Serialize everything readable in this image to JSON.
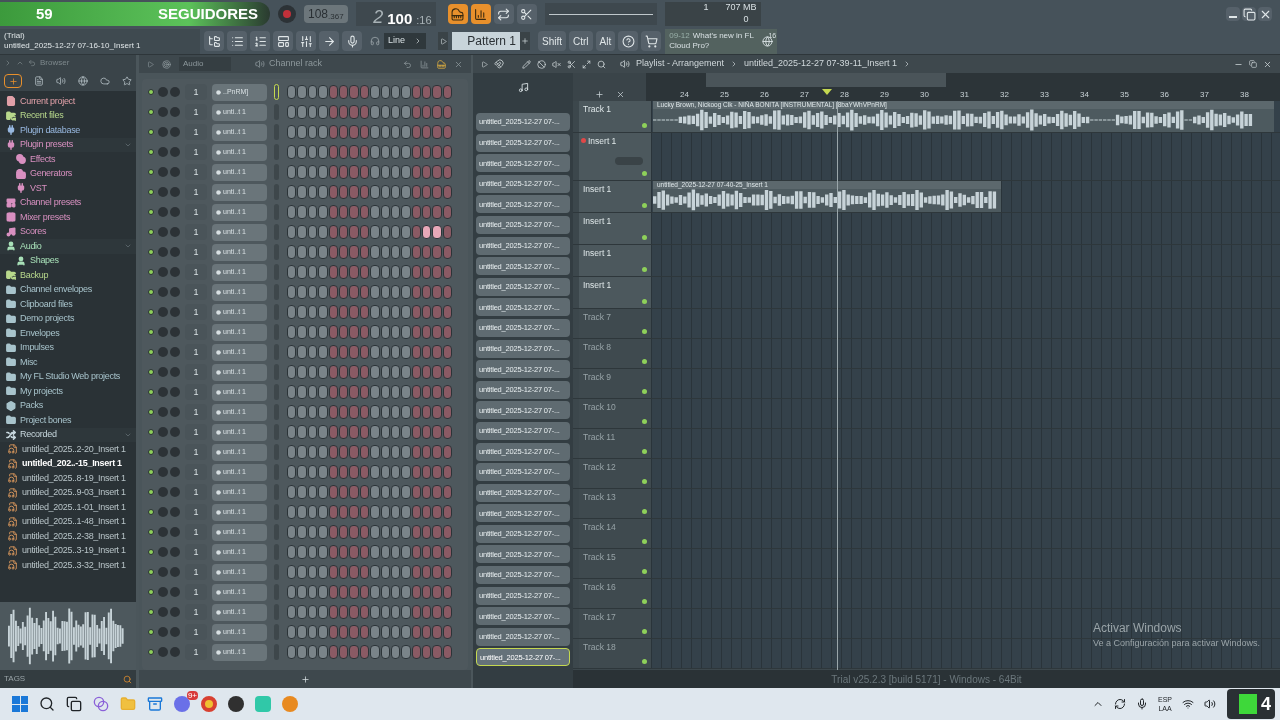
{
  "banner": {
    "count": "59",
    "label": "SEGUIDORES"
  },
  "transport": {
    "tempo": "108",
    "tempo_fraction": ".367",
    "time_bar": "2",
    "time_main": "100",
    "time_sub": ":16"
  },
  "monitor": {
    "cpu": "1",
    "ram": "707 MB",
    "voices": "0"
  },
  "hint_bar": {
    "mode": "(Trial)",
    "text": "untitled_2025-12-27 07-16-10_Insert 1"
  },
  "snap": "Line",
  "pattern": "Pattern 1",
  "modifiers": [
    "Shift",
    "Ctrl",
    "Alt"
  ],
  "news": {
    "date": "09-12",
    "text": "What's new in FL Cloud Pro?",
    "badge": "16"
  },
  "browser": {
    "title": "Browser",
    "tags_label": "TAGS",
    "items": [
      {
        "name": "Current project",
        "kind": "project",
        "color": "#e0a0a8"
      },
      {
        "name": "Recent files",
        "kind": "recent",
        "color": "#b8d88c"
      },
      {
        "name": "Plugin database",
        "kind": "plugin",
        "color": "#98b8e0"
      },
      {
        "name": "Plugin presets",
        "kind": "plugin",
        "color": "#d890c0",
        "expanded": true,
        "children": [
          {
            "name": "Effects",
            "kind": "effects",
            "color": "#d890c0"
          },
          {
            "name": "Generators",
            "kind": "generators",
            "color": "#d890c0"
          },
          {
            "name": "VST",
            "kind": "plugin",
            "color": "#d890c0"
          }
        ]
      },
      {
        "name": "Channel presets",
        "kind": "preset",
        "color": "#d890c0"
      },
      {
        "name": "Mixer presets",
        "kind": "mixer",
        "color": "#d890c0"
      },
      {
        "name": "Scores",
        "kind": "score",
        "color": "#d890c0"
      },
      {
        "name": "Audio",
        "kind": "audio",
        "color": "#a8e0b8",
        "expanded": true,
        "children": [
          {
            "name": "Shapes",
            "kind": "audio",
            "color": "#a8e0b8"
          }
        ]
      },
      {
        "name": "Backup",
        "kind": "recent",
        "color": "#b8d88c"
      },
      {
        "name": "Channel envelopes",
        "kind": "folder",
        "color": "#a8c4cc"
      },
      {
        "name": "Clipboard files",
        "kind": "folder",
        "color": "#a8c4cc"
      },
      {
        "name": "Demo projects",
        "kind": "folder",
        "color": "#a8c4cc"
      },
      {
        "name": "Envelopes",
        "kind": "folder",
        "color": "#a8c4cc"
      },
      {
        "name": "Impulses",
        "kind": "folder",
        "color": "#a8c4cc"
      },
      {
        "name": "Misc",
        "kind": "folder",
        "color": "#a8c4cc"
      },
      {
        "name": "My FL Studio Web projects",
        "kind": "folder",
        "color": "#a8c4cc"
      },
      {
        "name": "My projects",
        "kind": "folder",
        "color": "#a8c4cc"
      },
      {
        "name": "Packs",
        "kind": "packs",
        "color": "#a8c4cc"
      },
      {
        "name": "Project bones",
        "kind": "folder",
        "color": "#a8c4cc"
      },
      {
        "name": "Recorded",
        "kind": "recorded",
        "color": "#c8d8de",
        "expanded": true,
        "children": [
          {
            "name": "untitled_2025..2-20_Insert 1",
            "kind": "file",
            "selected": false
          },
          {
            "name": "untitled_202..-15_Insert 1",
            "kind": "file",
            "selected": true
          },
          {
            "name": "untitled_2025..8-19_Insert 1",
            "kind": "file",
            "selected": false
          },
          {
            "name": "untitled_2025..9-03_Insert 1",
            "kind": "file",
            "selected": false
          },
          {
            "name": "untitled_2025..1-01_Insert 1",
            "kind": "file",
            "selected": false
          },
          {
            "name": "untitled_2025..1-48_Insert 1",
            "kind": "file",
            "selected": false
          },
          {
            "name": "untitled_2025..2-38_Insert 1",
            "kind": "file",
            "selected": false
          },
          {
            "name": "untitled_2025..3-19_Insert 1",
            "kind": "file",
            "selected": false
          },
          {
            "name": "untitled_2025..3-32_Insert 1",
            "kind": "file",
            "selected": false
          }
        ]
      }
    ]
  },
  "channel_rack": {
    "filter": "Audio",
    "title": "Channel rack",
    "channels": [
      {
        "name": "..PnRM]",
        "route": "1",
        "selected": true,
        "steps": [
          false,
          false,
          false,
          false,
          false,
          false,
          false,
          false,
          false,
          false,
          false,
          false,
          false,
          false,
          false,
          false
        ]
      },
      {
        "name": "unti..t 1",
        "route": "1",
        "selected": false,
        "steps": [
          false,
          false,
          false,
          false,
          false,
          false,
          false,
          false,
          false,
          false,
          false,
          false,
          false,
          false,
          false,
          false
        ]
      },
      {
        "name": "unti..t 1",
        "route": "1",
        "selected": false,
        "steps": [
          false,
          false,
          false,
          false,
          false,
          false,
          false,
          false,
          false,
          false,
          false,
          false,
          false,
          false,
          false,
          false
        ]
      },
      {
        "name": "unti..t 1",
        "route": "1",
        "selected": false,
        "steps": [
          false,
          false,
          false,
          false,
          false,
          false,
          false,
          false,
          false,
          false,
          false,
          false,
          false,
          false,
          false,
          false
        ]
      },
      {
        "name": "unti..t 1",
        "route": "1",
        "selected": false,
        "steps": [
          false,
          false,
          false,
          false,
          false,
          false,
          false,
          false,
          false,
          false,
          false,
          false,
          false,
          false,
          false,
          false
        ]
      },
      {
        "name": "unti..t 1",
        "route": "1",
        "selected": false,
        "steps": [
          false,
          false,
          false,
          false,
          false,
          false,
          false,
          false,
          false,
          false,
          false,
          false,
          false,
          false,
          false,
          false
        ]
      },
      {
        "name": "unti..t 1",
        "route": "1",
        "selected": false,
        "steps": [
          false,
          false,
          false,
          false,
          false,
          false,
          false,
          false,
          false,
          false,
          false,
          false,
          false,
          false,
          false,
          false
        ]
      },
      {
        "name": "unti..t 1",
        "route": "1",
        "selected": false,
        "steps": [
          false,
          false,
          false,
          false,
          false,
          false,
          false,
          false,
          false,
          false,
          false,
          false,
          false,
          true,
          true,
          false
        ]
      },
      {
        "name": "unti..t 1",
        "route": "1",
        "selected": false,
        "steps": [
          false,
          false,
          false,
          false,
          false,
          false,
          false,
          false,
          false,
          false,
          false,
          false,
          false,
          false,
          false,
          false
        ]
      },
      {
        "name": "unti..t 1",
        "route": "1",
        "selected": false,
        "steps": [
          false,
          false,
          false,
          false,
          false,
          false,
          false,
          false,
          false,
          false,
          false,
          false,
          false,
          false,
          false,
          false
        ]
      },
      {
        "name": "unti..t 1",
        "route": "1",
        "selected": false,
        "steps": [
          false,
          false,
          false,
          false,
          false,
          false,
          false,
          false,
          false,
          false,
          false,
          false,
          false,
          false,
          false,
          false
        ]
      },
      {
        "name": "unti..t 1",
        "route": "1",
        "selected": false,
        "steps": [
          false,
          false,
          false,
          false,
          false,
          false,
          false,
          false,
          false,
          false,
          false,
          false,
          false,
          false,
          false,
          false
        ]
      },
      {
        "name": "unti..t 1",
        "route": "1",
        "selected": false,
        "steps": [
          false,
          false,
          false,
          false,
          false,
          false,
          false,
          false,
          false,
          false,
          false,
          false,
          false,
          false,
          false,
          false
        ]
      },
      {
        "name": "unti..t 1",
        "route": "1",
        "selected": false,
        "steps": [
          false,
          false,
          false,
          false,
          false,
          false,
          false,
          false,
          false,
          false,
          false,
          false,
          false,
          false,
          false,
          false
        ]
      },
      {
        "name": "unti..t 1",
        "route": "1",
        "selected": false,
        "steps": [
          false,
          false,
          false,
          false,
          false,
          false,
          false,
          false,
          false,
          false,
          false,
          false,
          false,
          false,
          false,
          false
        ]
      },
      {
        "name": "unti..t 1",
        "route": "1",
        "selected": false,
        "steps": [
          false,
          false,
          false,
          false,
          false,
          false,
          false,
          false,
          false,
          false,
          false,
          false,
          false,
          false,
          false,
          false
        ]
      },
      {
        "name": "unti..t 1",
        "route": "1",
        "selected": false,
        "steps": [
          false,
          false,
          false,
          false,
          false,
          false,
          false,
          false,
          false,
          false,
          false,
          false,
          false,
          false,
          false,
          false
        ]
      },
      {
        "name": "unti..t 1",
        "route": "1",
        "selected": false,
        "steps": [
          false,
          false,
          false,
          false,
          false,
          false,
          false,
          false,
          false,
          false,
          false,
          false,
          false,
          false,
          false,
          false
        ]
      },
      {
        "name": "unti..t 1",
        "route": "1",
        "selected": false,
        "steps": [
          false,
          false,
          false,
          false,
          false,
          false,
          false,
          false,
          false,
          false,
          false,
          false,
          false,
          false,
          false,
          false
        ]
      },
      {
        "name": "unti..t 1",
        "route": "1",
        "selected": false,
        "steps": [
          false,
          false,
          false,
          false,
          false,
          false,
          false,
          false,
          false,
          false,
          false,
          false,
          false,
          false,
          false,
          false
        ]
      },
      {
        "name": "unti..t 1",
        "route": "1",
        "selected": false,
        "steps": [
          false,
          false,
          false,
          false,
          false,
          false,
          false,
          false,
          false,
          false,
          false,
          false,
          false,
          false,
          false,
          false
        ]
      },
      {
        "name": "unti..t 1",
        "route": "1",
        "selected": false,
        "steps": [
          false,
          false,
          false,
          false,
          false,
          false,
          false,
          false,
          false,
          false,
          false,
          false,
          false,
          false,
          false,
          false
        ]
      },
      {
        "name": "unti..t 1",
        "route": "1",
        "selected": false,
        "steps": [
          false,
          false,
          false,
          false,
          false,
          false,
          false,
          false,
          false,
          false,
          false,
          false,
          false,
          false,
          false,
          false
        ]
      },
      {
        "name": "unti..t 1",
        "route": "1",
        "selected": false,
        "steps": [
          false,
          false,
          false,
          false,
          false,
          false,
          false,
          false,
          false,
          false,
          false,
          false,
          false,
          false,
          false,
          false
        ]
      },
      {
        "name": "unti..t 1",
        "route": "1",
        "selected": false,
        "steps": [
          false,
          false,
          false,
          false,
          false,
          false,
          false,
          false,
          false,
          false,
          false,
          false,
          false,
          false,
          false,
          false
        ]
      },
      {
        "name": "unti..t 1",
        "route": "1",
        "selected": false,
        "steps": [
          false,
          false,
          false,
          false,
          false,
          false,
          false,
          false,
          false,
          false,
          false,
          false,
          false,
          false,
          false,
          false
        ]
      },
      {
        "name": "unti..t 1",
        "route": "1",
        "selected": false,
        "steps": [
          false,
          false,
          false,
          false,
          false,
          false,
          false,
          false,
          false,
          false,
          false,
          false,
          false,
          false,
          false,
          false
        ]
      },
      {
        "name": "unti..t 1",
        "route": "1",
        "selected": false,
        "steps": [
          false,
          false,
          false,
          false,
          false,
          false,
          false,
          false,
          false,
          false,
          false,
          false,
          false,
          false,
          false,
          false
        ]
      },
      {
        "name": "unti..t 1",
        "route": "1",
        "selected": false,
        "steps": [
          false,
          false,
          false,
          false,
          false,
          false,
          false,
          false,
          false,
          false,
          false,
          false,
          false,
          false,
          false,
          false
        ]
      }
    ]
  },
  "playlist": {
    "title": "Playlist - Arrangement",
    "pattern": "untitled_2025-12-27 07-39-11_Insert 1",
    "patterns": [
      {
        "name": "untitled_2025-12-27 07-...",
        "selected": false
      },
      {
        "name": "untitled_2025-12-27 07-...",
        "selected": false
      },
      {
        "name": "untitled_2025-12-27 07-...",
        "selected": false
      },
      {
        "name": "untitled_2025-12-27 07-...",
        "selected": false
      },
      {
        "name": "untitled_2025-12-27 07-...",
        "selected": false
      },
      {
        "name": "untitled_2025-12-27 07-...",
        "selected": false
      },
      {
        "name": "untitled_2025-12-27 07-...",
        "selected": false
      },
      {
        "name": "untitled_2025-12-27 07-...",
        "selected": false
      },
      {
        "name": "untitled_2025-12-27 07-...",
        "selected": false
      },
      {
        "name": "untitled_2025-12-27 07-...",
        "selected": false
      },
      {
        "name": "untitled_2025-12-27 07-...",
        "selected": false
      },
      {
        "name": "untitled_2025-12-27 07-...",
        "selected": false
      },
      {
        "name": "untitled_2025-12-27 07-...",
        "selected": false
      },
      {
        "name": "untitled_2025-12-27 07-...",
        "selected": false
      },
      {
        "name": "untitled_2025-12-27 07-...",
        "selected": false
      },
      {
        "name": "untitled_2025-12-27 07-...",
        "selected": false
      },
      {
        "name": "untitled_2025-12-27 07-...",
        "selected": false
      },
      {
        "name": "untitled_2025-12-27 07-...",
        "selected": false
      },
      {
        "name": "untitled_2025-12-27 07-...",
        "selected": false
      },
      {
        "name": "untitled_2025-12-27 07-...",
        "selected": false
      },
      {
        "name": "untitled_2025-12-27 07-...",
        "selected": false
      },
      {
        "name": "untitled_2025-12-27 07-...",
        "selected": false
      },
      {
        "name": "untitled_2025-12-27 07-...",
        "selected": false
      },
      {
        "name": "untitled_2025-12-27 07-...",
        "selected": false
      },
      {
        "name": "untitled_2025-12-27 07-...",
        "selected": false
      },
      {
        "name": "untitled_2025-12-27 07-...",
        "selected": false
      },
      {
        "name": "untitled_2025-12-27 07-...",
        "selected": true
      }
    ],
    "bars": [
      "24",
      "25",
      "26",
      "27",
      "28",
      "29",
      "30",
      "31",
      "32",
      "33",
      "34",
      "35",
      "36",
      "37",
      "38"
    ],
    "tracks": [
      {
        "name": "Track 1",
        "empty": false,
        "armed": false,
        "clip": "Lucky Brown, Nickoog Clk - NIÑA BONITA [INSTRUMENTAL] [8baYWhVPnRM]"
      },
      {
        "name": "Insert 1",
        "empty": false,
        "armed": true
      },
      {
        "name": "Insert 1",
        "empty": false,
        "armed": false,
        "clip": "untitled_2025-12-27 07-40-25_Insert 1"
      },
      {
        "name": "Insert 1",
        "empty": false,
        "armed": false
      },
      {
        "name": "Insert 1",
        "empty": false,
        "armed": false
      },
      {
        "name": "Insert 1",
        "empty": false,
        "armed": false
      },
      {
        "name": "Track 7",
        "empty": true,
        "armed": false
      },
      {
        "name": "Track 8",
        "empty": true,
        "armed": false
      },
      {
        "name": "Track 9",
        "empty": true,
        "armed": false
      },
      {
        "name": "Track 10",
        "empty": true,
        "armed": false
      },
      {
        "name": "Track 11",
        "empty": true,
        "armed": false
      },
      {
        "name": "Track 12",
        "empty": true,
        "armed": false
      },
      {
        "name": "Track 13",
        "empty": true,
        "armed": false
      },
      {
        "name": "Track 14",
        "empty": true,
        "armed": false
      },
      {
        "name": "Track 15",
        "empty": true,
        "armed": false
      },
      {
        "name": "Track 16",
        "empty": true,
        "armed": false
      },
      {
        "name": "Track 17",
        "empty": true,
        "armed": false
      },
      {
        "name": "Track 18",
        "empty": true,
        "armed": false
      }
    ]
  },
  "status": "Trial v25.2.3 [build 5171] - Windows - 64Bit",
  "activation": {
    "title": "Activar Windows",
    "text": "Ve a Configuración para activar Windows."
  },
  "taskbar": {
    "badge": "9+",
    "language": "ESP",
    "layout": "LAA"
  },
  "stream_logo": "4"
}
